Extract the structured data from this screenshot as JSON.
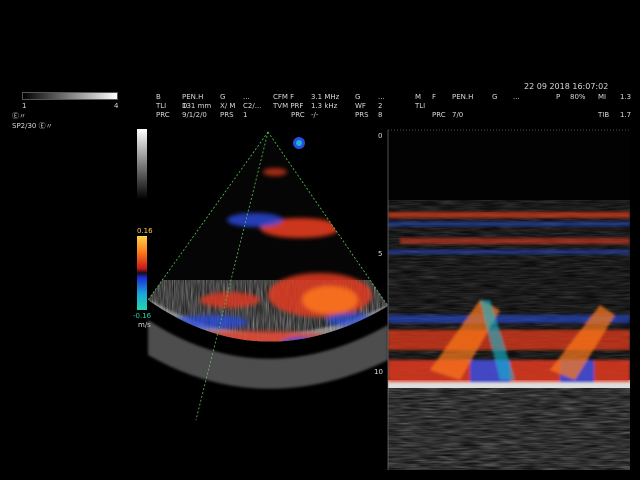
{
  "top_left": {
    "scale_min": "1",
    "scale_max": "4",
    "probe_a": "Ⓔ〃",
    "probe_b": "SP2/30 Ⓔ〃"
  },
  "datetime": "22  09  2018  16:07:02",
  "params_row1": [
    "B",
    "PEN.H",
    "G",
    "...",
    "CFM F",
    "3.1 MHz",
    "G",
    "...",
    "M",
    "F",
    "PEN.H",
    "G",
    "...",
    "P",
    "80%",
    "MI",
    "1.3"
  ],
  "params_row2": [
    "TLI",
    "D",
    "131 mm",
    "X/ M",
    "C2/...",
    "TVM PRF",
    "1.3 kHz",
    "WF",
    "2",
    "TLI"
  ],
  "params_row3": [
    "PRC",
    "9/1/2/0",
    "PRS",
    "1",
    "PRC",
    "-/-",
    "PRS",
    "8",
    "PRC",
    "7/0",
    "TIB",
    "1.7"
  ],
  "color_scale": {
    "top": "0.16",
    "bottom": "-0.16",
    "unit": "m/s"
  },
  "mmode_depth_labels": [
    "0",
    "5",
    "10"
  ],
  "colors": {
    "red": "#e23a1e",
    "orange": "#ff7a1a",
    "blue": "#2a4be0",
    "cyan": "#18b9d0",
    "green_line": "#53c653"
  }
}
